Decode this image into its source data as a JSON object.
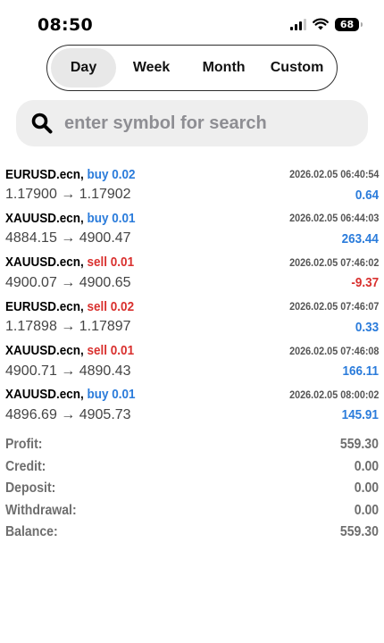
{
  "status_bar": {
    "time": "08:50",
    "battery": "68",
    "icons": [
      "signal-icon",
      "wifi-icon",
      "battery-icon"
    ]
  },
  "period_tabs": [
    {
      "label": "Day",
      "active": true
    },
    {
      "label": "Week",
      "active": false
    },
    {
      "label": "Month",
      "active": false
    },
    {
      "label": "Custom",
      "active": false
    }
  ],
  "search": {
    "placeholder": "enter symbol for search",
    "value": ""
  },
  "colors": {
    "buy": "#2b7cdb",
    "sell": "#d9312f",
    "profit_positive": "#2b7cdb",
    "profit_negative": "#d9312f"
  },
  "deals": [
    {
      "symbol": "EURUSD.ecn,",
      "side": "buy 0.02",
      "type": "buy",
      "time": "2026.02.05 06:40:54",
      "prices": "1.17900 → 1.17902",
      "profit": "0.64"
    },
    {
      "symbol": "XAUUSD.ecn,",
      "side": "buy 0.01",
      "type": "buy",
      "time": "2026.02.05 06:44:03",
      "prices": "4884.15 → 4900.47",
      "profit": "263.44"
    },
    {
      "symbol": "XAUUSD.ecn,",
      "side": "sell 0.01",
      "type": "sell",
      "time": "2026.02.05 07:46:02",
      "prices": "4900.07 → 4900.65",
      "profit": "-9.37"
    },
    {
      "symbol": "EURUSD.ecn,",
      "side": "sell 0.02",
      "type": "sell",
      "time": "2026.02.05 07:46:07",
      "prices": "1.17898 → 1.17897",
      "profit": "0.33"
    },
    {
      "symbol": "XAUUSD.ecn,",
      "side": "sell 0.01",
      "type": "sell",
      "time": "2026.02.05 07:46:08",
      "prices": "4900.71 → 4890.43",
      "profit": "166.11"
    },
    {
      "symbol": "XAUUSD.ecn,",
      "side": "buy 0.01",
      "type": "buy",
      "time": "2026.02.05 08:00:02",
      "prices": "4896.69 → 4905.73",
      "profit": "145.91"
    }
  ],
  "summary": [
    {
      "label": "Profit:",
      "value": "559.30"
    },
    {
      "label": "Credit:",
      "value": "0.00"
    },
    {
      "label": "Deposit:",
      "value": "0.00"
    },
    {
      "label": "Withdrawal:",
      "value": "0.00"
    },
    {
      "label": "Balance:",
      "value": "559.30"
    }
  ]
}
